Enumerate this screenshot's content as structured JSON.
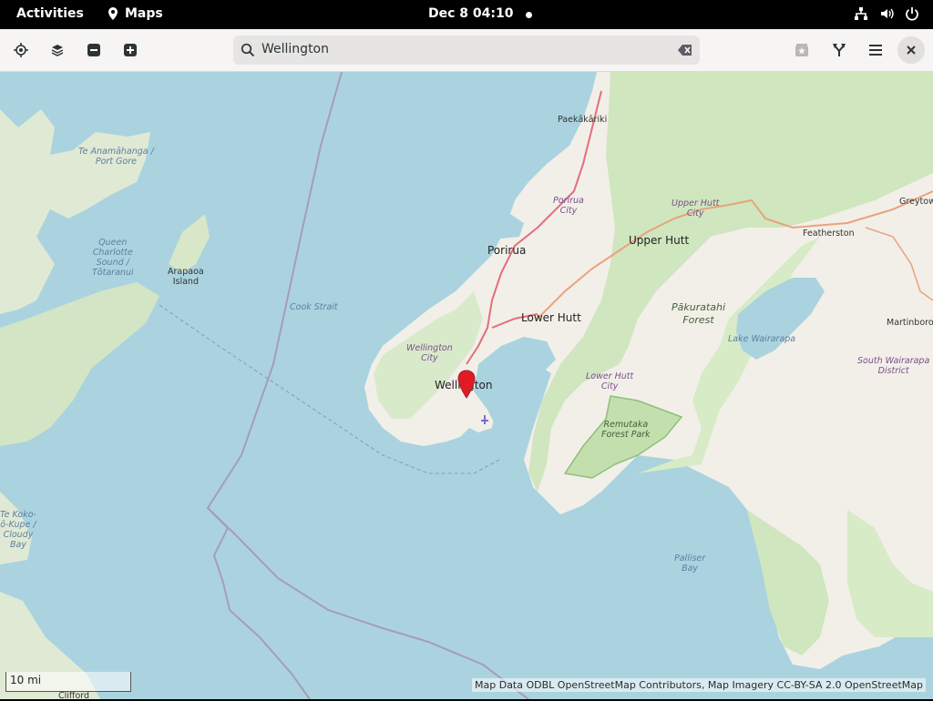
{
  "topbar": {
    "activities": "Activities",
    "app_name": "Maps",
    "clock": "Dec 8  04:10"
  },
  "search": {
    "value": "Wellington",
    "placeholder": "Search"
  },
  "map": {
    "scale_label": "10 mi",
    "attribution": "Map Data ODBL OpenStreetMap Contributors, Map Imagery CC-BY-SA 2.0 OpenStreetMap",
    "labels": {
      "paekakariki": "Paekākāriki",
      "porirua_city": "Porirua\nCity",
      "porirua": "Porirua",
      "upper_hutt_city": "Upper Hutt\nCity",
      "upper_hutt": "Upper Hutt",
      "featherston": "Featherston",
      "greytown": "Greytow",
      "lower_hutt": "Lower Hutt",
      "wellington_city": "Wellington\nCity",
      "wellington": "Wellington",
      "lower_hutt_city": "Lower Hutt\nCity",
      "pakuratahi": "Pākuratahi\nForest",
      "lake_wairarapa": "Lake Wairarapa",
      "south_wairarapa": "South Wairarapa\nDistrict",
      "martinborough": "Martinboro",
      "remutaka": "Remutaka\nForest Park",
      "cook_strait": "Cook Strait",
      "te_anamahanga": "Te Anamāhanga /\nPort Gore",
      "queen_charlotte": "Queen\nCharlotte\nSound /\nTōtaranui",
      "arapaoa": "Arapaoa\nIsland",
      "te_koko": "Te Koko-\nō-Kupe /\nCloudy\nBay",
      "palliser": "Palliser\nBay",
      "clifford": "Clifford"
    }
  },
  "colors": {
    "sea": "#aad3df",
    "land": "#f2efe9",
    "forest": "#cfe6bf",
    "road": "#e46e7a"
  }
}
